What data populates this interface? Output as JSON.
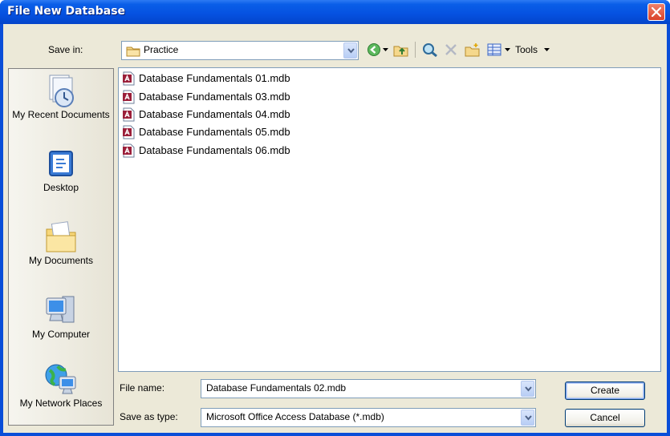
{
  "window": {
    "title": "File New Database"
  },
  "save_in": {
    "label": "Save in:",
    "value": "Practice"
  },
  "toolbar": {
    "tools_label": "Tools"
  },
  "places": [
    {
      "label": "My Recent Documents",
      "icon": "recent-documents-icon"
    },
    {
      "label": "Desktop",
      "icon": "desktop-icon"
    },
    {
      "label": "My Documents",
      "icon": "my-documents-icon"
    },
    {
      "label": "My Computer",
      "icon": "my-computer-icon"
    },
    {
      "label": "My Network Places",
      "icon": "network-places-icon"
    }
  ],
  "files": [
    "Database Fundamentals 01.mdb",
    "Database Fundamentals 03.mdb",
    "Database Fundamentals 04.mdb",
    "Database Fundamentals 05.mdb",
    "Database Fundamentals 06.mdb"
  ],
  "file_name": {
    "label": "File name:",
    "value": "Database Fundamentals 02.mdb"
  },
  "save_as_type": {
    "label": "Save as type:",
    "value": "Microsoft Office Access Database (*.mdb)"
  },
  "buttons": {
    "create": "Create",
    "cancel": "Cancel"
  },
  "colors": {
    "title_bar": "#0551e0",
    "dialog_bg": "#ece9d8",
    "close_button": "#d9422a"
  }
}
